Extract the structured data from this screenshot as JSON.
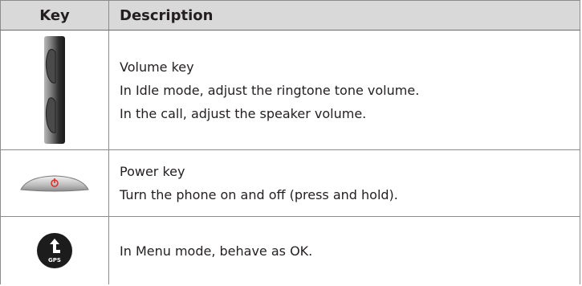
{
  "table": {
    "headers": {
      "key": "Key",
      "description": "Description"
    },
    "rows": [
      {
        "icon": "volume-key-icon",
        "lines": [
          "Volume key",
          "In Idle mode, adjust the ringtone tone volume.",
          "In the call, adjust the speaker volume."
        ]
      },
      {
        "icon": "power-key-icon",
        "lines": [
          "Power key",
          "Turn the phone on and off (press and hold)."
        ]
      },
      {
        "icon": "gps-key-icon",
        "icon_label": "GPS",
        "lines": [
          "In Menu mode, behave as OK."
        ]
      }
    ]
  },
  "colors": {
    "header_bg": "#d9d9d9",
    "border": "#8c8c8c",
    "text": "#231f20",
    "power_accent": "#e0302a"
  }
}
